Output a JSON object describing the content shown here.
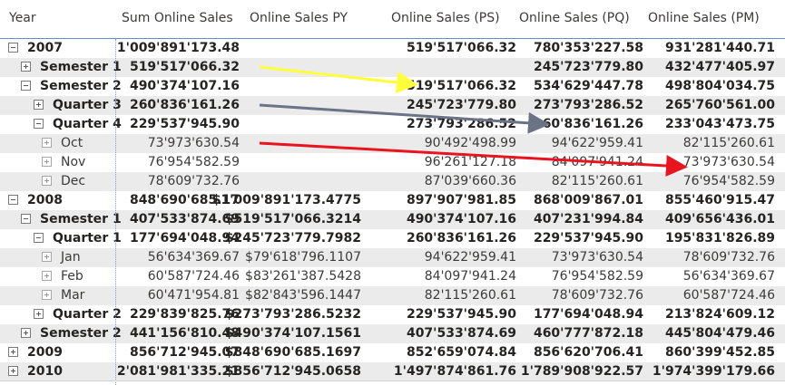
{
  "headers": [
    "Year",
    "Sum Online Sales",
    "Online Sales PY",
    "Online Sales (PS)",
    "Online Sales (PQ)",
    "Online Sales (PM)"
  ],
  "rows": [
    {
      "label": "2007",
      "level": 0,
      "toggle": "minus",
      "bold": true,
      "shade": false,
      "values": [
        "1'009'891'173.48",
        "",
        "519'517'066.32",
        "780'353'227.58",
        "931'281'440.71"
      ]
    },
    {
      "label": "Semester 1",
      "level": 1,
      "toggle": "plus",
      "bold": true,
      "shade": true,
      "values": [
        "519'517'066.32",
        "",
        "",
        "245'723'779.80",
        "432'477'405.97"
      ]
    },
    {
      "label": "Semester 2",
      "level": 1,
      "toggle": "minus",
      "bold": true,
      "shade": false,
      "values": [
        "490'374'107.16",
        "",
        "519'517'066.32",
        "534'629'447.78",
        "498'804'034.75"
      ]
    },
    {
      "label": "Quarter 3",
      "level": 2,
      "toggle": "plus",
      "bold": true,
      "shade": true,
      "values": [
        "260'836'161.26",
        "",
        "245'723'779.80",
        "273'793'286.52",
        "265'760'561.00"
      ]
    },
    {
      "label": "Quarter 4",
      "level": 2,
      "toggle": "minus",
      "bold": true,
      "shade": false,
      "values": [
        "229'537'945.90",
        "",
        "273'793'286.52",
        "260'836'161.26",
        "233'043'473.75"
      ]
    },
    {
      "label": "Oct",
      "level": 3,
      "toggle": "leaf",
      "bold": false,
      "shade": true,
      "values": [
        "73'973'630.54",
        "",
        "90'492'498.99",
        "94'622'959.41",
        "82'115'260.61"
      ]
    },
    {
      "label": "Nov",
      "level": 3,
      "toggle": "leaf",
      "bold": false,
      "shade": false,
      "values": [
        "76'954'582.59",
        "",
        "96'261'127.18",
        "84'097'941.24",
        "73'973'630.54"
      ]
    },
    {
      "label": "Dec",
      "level": 3,
      "toggle": "leaf",
      "bold": false,
      "shade": true,
      "values": [
        "78'609'732.76",
        "",
        "87'039'660.36",
        "82'115'260.61",
        "76'954'582.59"
      ]
    },
    {
      "label": "2008",
      "level": 0,
      "toggle": "minus",
      "bold": true,
      "shade": false,
      "values": [
        "848'690'685.17",
        "$1'009'891'173.4775",
        "897'907'981.85",
        "868'009'867.01",
        "855'460'915.47"
      ]
    },
    {
      "label": "Semester 1",
      "level": 1,
      "toggle": "minus",
      "bold": true,
      "shade": true,
      "values": [
        "407'533'874.69",
        "$519'517'066.3214",
        "490'374'107.16",
        "407'231'994.84",
        "409'656'436.01"
      ]
    },
    {
      "label": "Quarter 1",
      "level": 2,
      "toggle": "minus",
      "bold": true,
      "shade": false,
      "values": [
        "177'694'048.94",
        "$245'723'779.7982",
        "260'836'161.26",
        "229'537'945.90",
        "195'831'826.89"
      ]
    },
    {
      "label": "Jan",
      "level": 3,
      "toggle": "leaf",
      "bold": false,
      "shade": true,
      "values": [
        "56'634'369.67",
        "$79'618'796.1107",
        "94'622'959.41",
        "73'973'630.54",
        "78'609'732.76"
      ]
    },
    {
      "label": "Feb",
      "level": 3,
      "toggle": "leaf",
      "bold": false,
      "shade": false,
      "values": [
        "60'587'724.46",
        "$83'261'387.5428",
        "84'097'941.24",
        "76'954'582.59",
        "56'634'369.67"
      ]
    },
    {
      "label": "Mar",
      "level": 3,
      "toggle": "leaf",
      "bold": false,
      "shade": true,
      "values": [
        "60'471'954.81",
        "$82'843'596.1447",
        "82'115'260.61",
        "78'609'732.76",
        "60'587'724.46"
      ]
    },
    {
      "label": "Quarter 2",
      "level": 2,
      "toggle": "plus",
      "bold": true,
      "shade": false,
      "values": [
        "229'839'825.76",
        "$273'793'286.5232",
        "229'537'945.90",
        "177'694'048.94",
        "213'824'609.12"
      ]
    },
    {
      "label": "Semester 2",
      "level": 1,
      "toggle": "plus",
      "bold": true,
      "shade": true,
      "values": [
        "441'156'810.48",
        "$490'374'107.1561",
        "407'533'874.69",
        "460'777'872.18",
        "445'804'479.46"
      ]
    },
    {
      "label": "2009",
      "level": 0,
      "toggle": "plus",
      "bold": true,
      "shade": false,
      "values": [
        "856'712'945.07",
        "$848'690'685.1697",
        "852'659'074.84",
        "856'620'706.41",
        "860'399'452.85"
      ]
    },
    {
      "label": "2010",
      "level": 0,
      "toggle": "plus",
      "bold": true,
      "shade": true,
      "values": [
        "2'081'981'335.21",
        "$856'712'945.0658",
        "1'497'874'861.76",
        "1'789'908'922.57",
        "1'974'399'179.66"
      ]
    }
  ],
  "arrows": [
    {
      "name": "yellow-arrow",
      "color": "#ffff3b"
    },
    {
      "name": "gray-arrow",
      "color": "#6b7387"
    },
    {
      "name": "red-arrow",
      "color": "#e8141e"
    }
  ]
}
